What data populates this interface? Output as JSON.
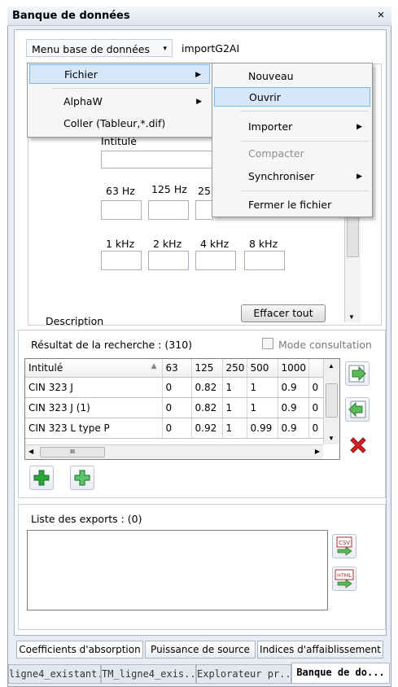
{
  "window": {
    "title": "Banque de données",
    "close": "×"
  },
  "db_menu": {
    "label": "Menu base de données",
    "dropdown": "▾",
    "import_label": "importG2AI"
  },
  "search": {
    "title_label": "Intitulé",
    "freq_labels_row1": [
      "63 Hz",
      "125 Hz",
      "25"
    ],
    "freq_labels_row2": [
      "1 kHz",
      "2 kHz",
      "4 kHz",
      "8 kHz"
    ],
    "description_label": "Description",
    "clear_button": "Effacer tout"
  },
  "results": {
    "title": "Résultat de la recherche : (310)",
    "consult_mode": "Mode consultation",
    "columns": [
      "Intitulé",
      "63",
      "125",
      "250",
      "500",
      "1000"
    ],
    "rows": [
      [
        "CIN 323 J",
        "0",
        "0.82",
        "1",
        "1",
        "0.9",
        "0"
      ],
      [
        "CIN 323 J (1)",
        "0",
        "0.82",
        "1",
        "1",
        "0.9",
        "0"
      ],
      [
        "CIN 323 L type P",
        "0",
        "0.92",
        "1",
        "0.99",
        "0.9",
        "0"
      ]
    ],
    "hscroll_thumb": "III"
  },
  "exports": {
    "title": "Liste des exports : (0)"
  },
  "tabs": [
    "Coefficients d'absorption",
    "Puissance de source",
    "Indices d'affaiblissement"
  ],
  "doc_tabs": [
    "ligne4_existant...",
    "TM_ligne4_exis...",
    "Explorateur pr...",
    "Banque de do..."
  ],
  "menu1": {
    "items": [
      "Fichier",
      "AlphaW",
      "Coller (Tableur,*.dif)"
    ],
    "submenu_arrow": "▶"
  },
  "menu2": {
    "items": [
      "Nouveau",
      "Ouvrir",
      "Importer",
      "Compacter",
      "Synchroniser",
      "Fermer le fichier"
    ]
  },
  "colors": {
    "accent": "#d5e7f9",
    "delete": "#d42323",
    "add": "#2aa63a",
    "arrow": "#5cb85c"
  }
}
